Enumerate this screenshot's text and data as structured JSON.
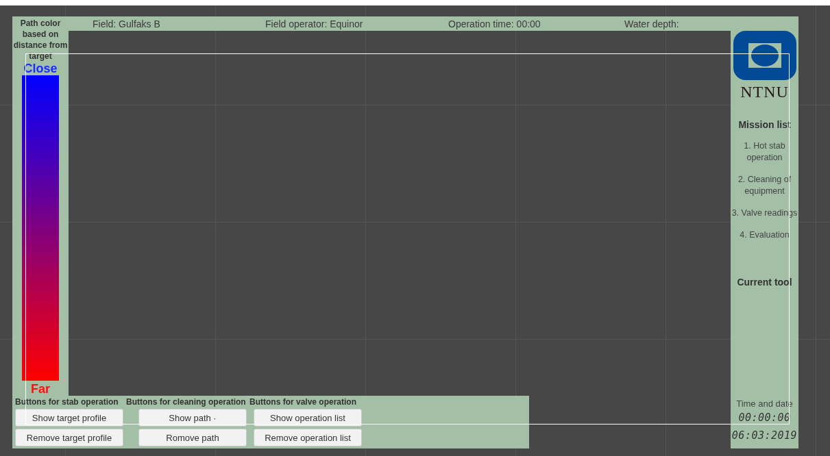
{
  "header": {
    "field": "Field: Gulfaks B",
    "operator": "Field operator: Equinor",
    "operation_time": "Operation time: 00:00",
    "water_depth": "Water depth:"
  },
  "legend": {
    "title": "Path color based on distance from target",
    "near_label": "Close",
    "far_label": "Far"
  },
  "button_groups": [
    {
      "title": "Buttons for stab operation",
      "buttons": [
        "Show target profile",
        "Remove target profile"
      ]
    },
    {
      "title": "Buttons for cleaning operation",
      "buttons": [
        "Show path ·",
        "Romove path"
      ]
    },
    {
      "title": "Buttons for valve operation",
      "buttons": [
        "Show operation list",
        "Remove operation list"
      ]
    }
  ],
  "sidebar": {
    "logo_text": "NTNU",
    "mission_title": "Mission list",
    "missions": [
      "1. Hot stab operation",
      "2. Cleaning of equipment",
      "3. Valve readings",
      "4. Evaluation"
    ],
    "current_tool_title": "Current tool",
    "clock_title": "Time and date",
    "time": "00:00:00",
    "date": "06:03:2019"
  }
}
